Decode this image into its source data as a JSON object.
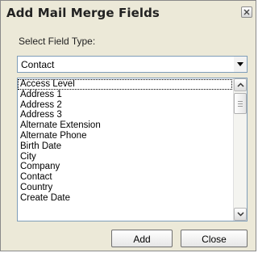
{
  "dialog": {
    "title": "Add Mail Merge Fields",
    "close_icon": "close-icon"
  },
  "field_type": {
    "label": "Select Field Type:",
    "selected": "Contact",
    "dropdown_icon": "chevron-down-icon"
  },
  "fields": {
    "items": [
      "Access Level",
      "Address 1",
      "Address 2",
      "Address 3",
      "Alternate Extension",
      "Alternate Phone",
      "Birth Date",
      "City",
      "Company",
      "Contact",
      "Country",
      "Create Date"
    ],
    "focused_index": 0
  },
  "buttons": {
    "add_label": "Add",
    "close_label": "Close"
  }
}
